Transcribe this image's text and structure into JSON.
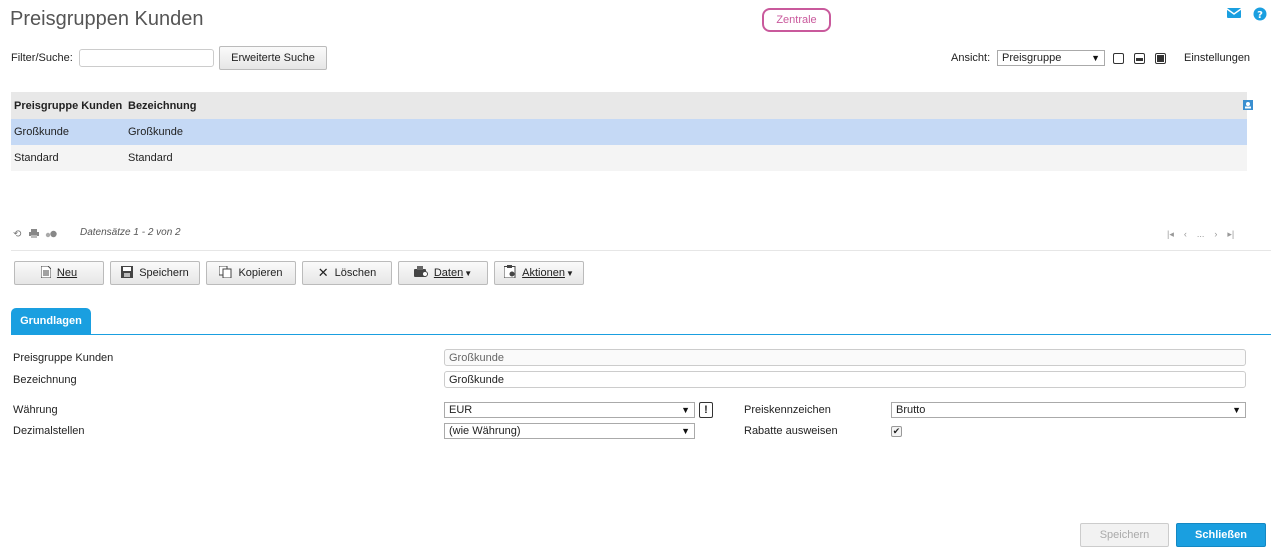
{
  "header": {
    "title": "Preisgruppen Kunden",
    "zentrale_label": "Zentrale",
    "mail_icon": "envelope-icon",
    "help_icon": "help-icon"
  },
  "filter": {
    "label": "Filter/Suche:",
    "value": "",
    "search_button": "Erweiterte Suche"
  },
  "view": {
    "label": "Ansicht:",
    "selected": "Preisgruppe",
    "settings_label": "Einstellungen"
  },
  "grid": {
    "columns": [
      "Preisgruppe Kunden",
      "Bezeichnung"
    ],
    "rows": [
      {
        "group": "Großkunde",
        "label": "Großkunde",
        "selected": true
      },
      {
        "group": "Standard",
        "label": "Standard",
        "selected": false
      }
    ],
    "pager_text": "Datensätze 1 - 2 von 2",
    "pager_ellipsis": "..."
  },
  "toolbar": {
    "new": "Neu",
    "save": "Speichern",
    "copy": "Kopieren",
    "delete": "Löschen",
    "data": "Daten",
    "actions": "Aktionen"
  },
  "tabs": [
    {
      "label": "Grundlagen",
      "active": true
    }
  ],
  "form": {
    "price_group_label": "Preisgruppe Kunden",
    "price_group_value": "Großkunde",
    "description_label": "Bezeichnung",
    "description_value": "Großkunde",
    "currency_label": "Währung",
    "currency_value": "EUR",
    "decimals_label": "Dezimalstellen",
    "decimals_value": "(wie Währung)",
    "price_flag_label": "Preiskennzeichen",
    "price_flag_value": "Brutto",
    "show_discounts_label": "Rabatte ausweisen",
    "show_discounts_checked": true
  },
  "footer": {
    "save": "Speichern",
    "close": "Schließen"
  },
  "colors": {
    "accent": "#1a9fe0",
    "zentrale": "#c9599c",
    "selected_row": "#c5d9f5"
  }
}
